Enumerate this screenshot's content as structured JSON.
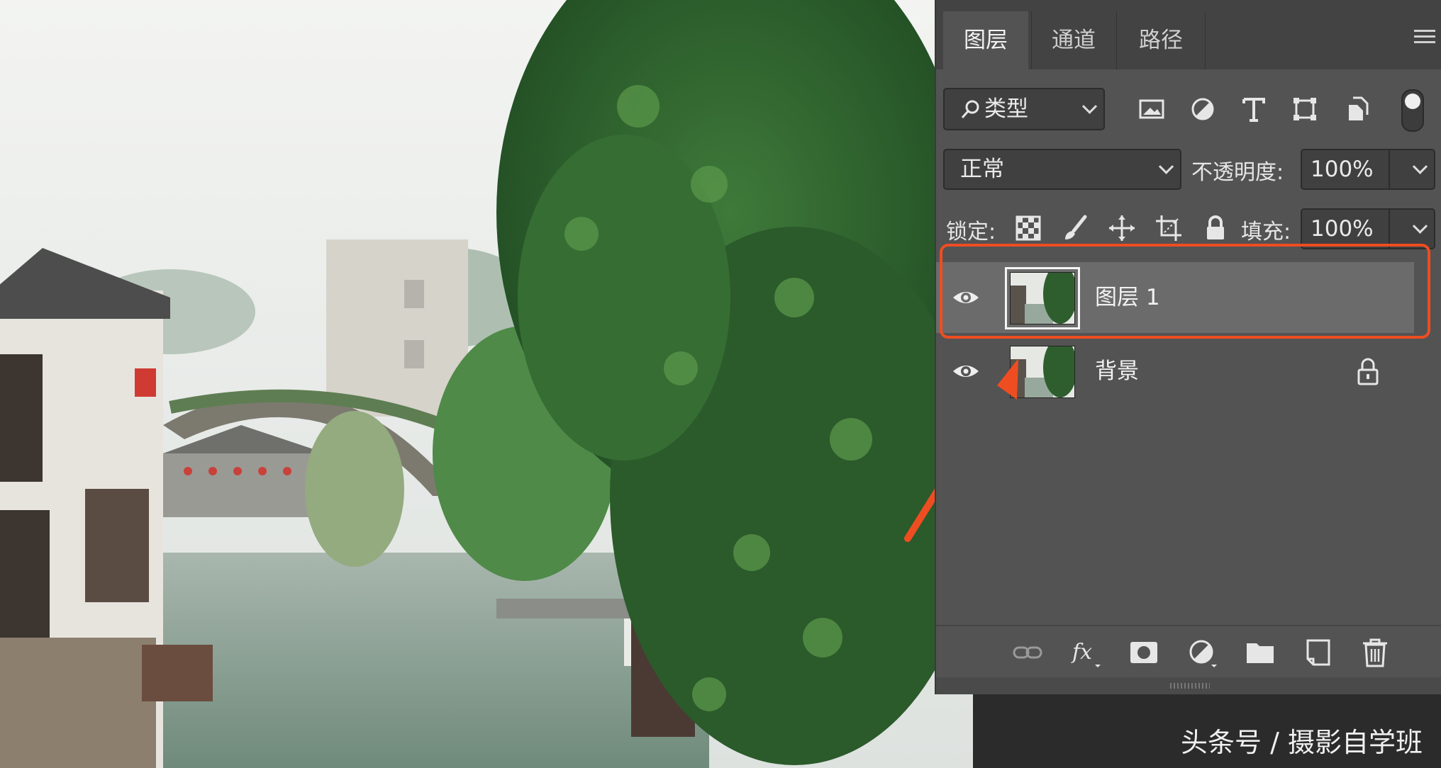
{
  "panel": {
    "tabs": [
      {
        "label": "图层",
        "active": true
      },
      {
        "label": "通道",
        "active": false
      },
      {
        "label": "路径",
        "active": false
      }
    ],
    "filter": {
      "label": "类型",
      "icons": [
        "image-filter-icon",
        "adjustment-filter-icon",
        "type-filter-icon",
        "shape-filter-icon",
        "smart-object-filter-icon"
      ]
    },
    "blend": {
      "mode": "正常",
      "opacity_label": "不透明度:",
      "opacity": "100%"
    },
    "lock": {
      "label": "锁定:",
      "fill_label": "填充:",
      "fill": "100%"
    },
    "layers": [
      {
        "name": "图层 1",
        "visible": true,
        "selected": true,
        "locked": false
      },
      {
        "name": "背景",
        "visible": true,
        "selected": false,
        "locked": true
      }
    ],
    "bottom_icons": [
      "link-layers-icon",
      "fx-icon",
      "add-mask-icon",
      "adjustment-layer-icon",
      "new-group-icon",
      "new-layer-icon",
      "delete-layer-icon"
    ]
  },
  "annotation": {
    "highlight_color": "#ee4d22"
  },
  "watermark": "头条号 / 摄影自学班"
}
